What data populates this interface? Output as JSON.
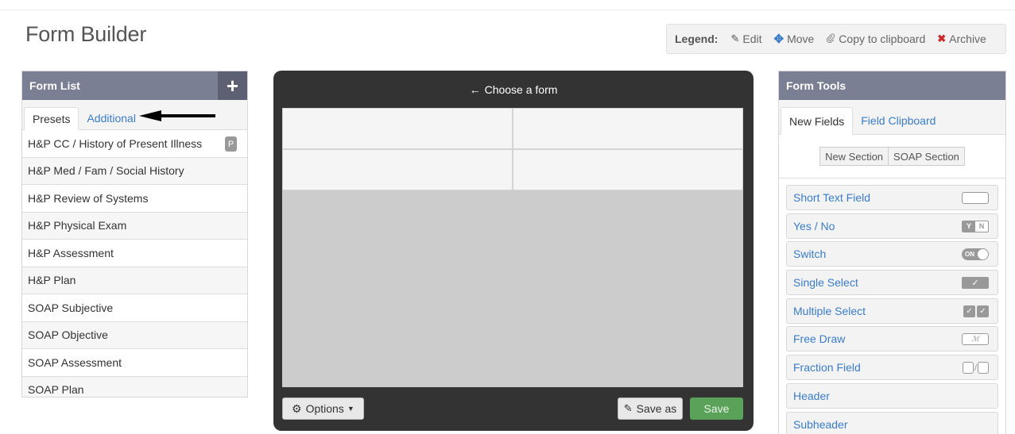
{
  "page": {
    "title": "Form Builder"
  },
  "legend": {
    "label": "Legend:",
    "items": [
      {
        "icon": "pencil-icon",
        "glyph": "✎",
        "label": "Edit"
      },
      {
        "icon": "move-icon",
        "glyph": "✥",
        "label": "Move"
      },
      {
        "icon": "paperclip-icon",
        "glyph": "⌕",
        "label": "Copy to clipboard"
      },
      {
        "icon": "archive-x-icon",
        "glyph": "✖",
        "label": "Archive"
      }
    ]
  },
  "form_list": {
    "title": "Form List",
    "add_glyph": "+",
    "tabs": [
      {
        "label": "Presets"
      },
      {
        "label": "Additional"
      }
    ],
    "items": [
      {
        "label": "H&P CC / History of Present Illness",
        "badge": "P"
      },
      {
        "label": "H&P Med / Fam / Social History"
      },
      {
        "label": "H&P Review of Systems"
      },
      {
        "label": "H&P Physical Exam"
      },
      {
        "label": "H&P Assessment"
      },
      {
        "label": "H&P Plan"
      },
      {
        "label": "SOAP Subjective"
      },
      {
        "label": "SOAP Objective"
      },
      {
        "label": "SOAP Assessment"
      },
      {
        "label": "SOAP Plan"
      }
    ]
  },
  "canvas": {
    "title_glyph": "←",
    "title": "Choose a form",
    "options_glyph": "⚙",
    "options_label": "Options",
    "save_as_glyph": "✎",
    "save_as_label": "Save as",
    "save_label": "Save"
  },
  "form_tools": {
    "title": "Form Tools",
    "tabs": [
      {
        "label": "New Fields"
      },
      {
        "label": "Field Clipboard"
      }
    ],
    "section_buttons": [
      {
        "label": "New Section"
      },
      {
        "label": "SOAP Section"
      }
    ],
    "fields": [
      {
        "label": "Short Text Field",
        "icon": "text-field-icon"
      },
      {
        "label": "Yes / No",
        "icon": "yes-no-icon",
        "y": "Y",
        "n": "N"
      },
      {
        "label": "Switch",
        "icon": "switch-icon",
        "text": "ON"
      },
      {
        "label": "Single Select",
        "icon": "single-select-icon",
        "glyph": "✓"
      },
      {
        "label": "Multiple Select",
        "icon": "multiple-select-icon",
        "glyph": "✓"
      },
      {
        "label": "Free Draw",
        "icon": "free-draw-icon",
        "text": "ℳ"
      },
      {
        "label": "Fraction Field",
        "icon": "fraction-icon",
        "slash": "/"
      },
      {
        "label": "Header"
      },
      {
        "label": "Subheader"
      }
    ]
  }
}
